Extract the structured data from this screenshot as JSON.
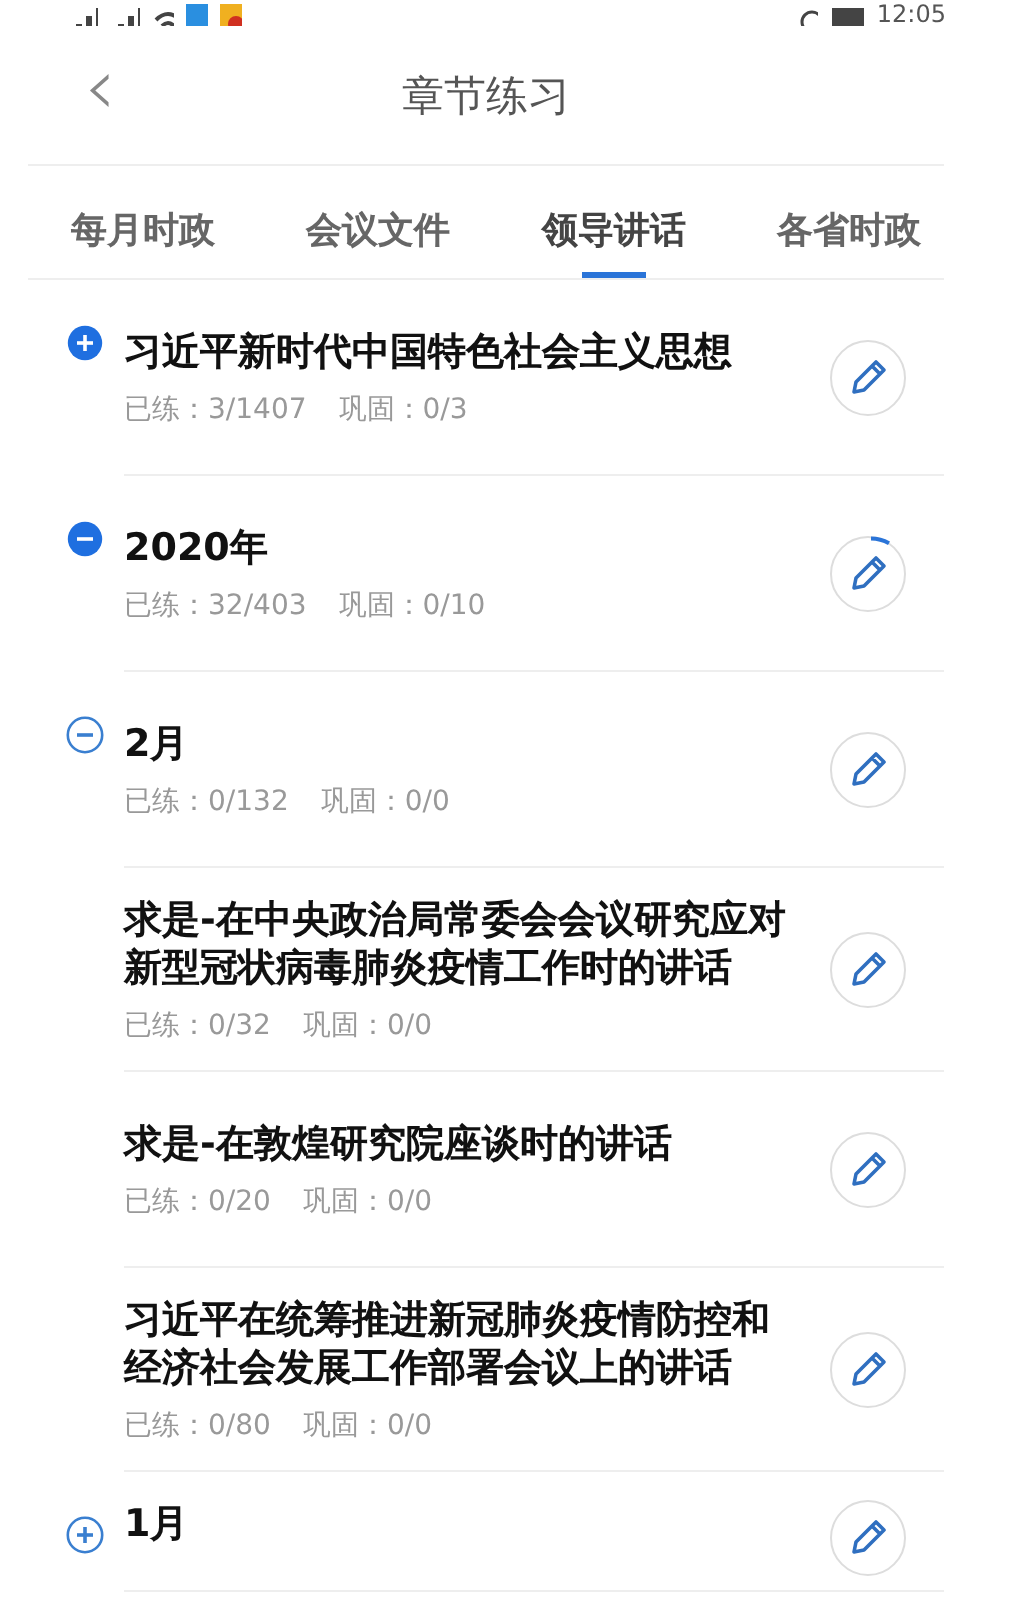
{
  "status_bar": {
    "time": "12:05"
  },
  "header": {
    "back_icon": "‹",
    "title": "章节练习"
  },
  "tabs": [
    {
      "label": "每月时政",
      "selected": false
    },
    {
      "label": "会议文件",
      "selected": false
    },
    {
      "label": "领导讲话",
      "selected": true
    },
    {
      "label": "各省时政",
      "selected": false
    }
  ],
  "items": [
    {
      "title": "习近平新时代中国特色社会主义思想",
      "practiced": "已练：3/1407",
      "review": "巩固：0/3",
      "expanded": false,
      "in_progress": false
    },
    {
      "title": "2020年",
      "practiced": "已练：32/403",
      "review": "巩固：0/10",
      "expanded": true,
      "in_progress": true,
      "children": [
        {
          "title": "2月",
          "practiced": "已练：0/132",
          "review": "巩固：0/0",
          "expanded": true,
          "in_progress": false,
          "children": [
            {
              "title": "求是-在中央政治局常委会会议研究应对新型冠状病毒肺炎疫情工作时的讲话",
              "practiced": "已练：0/32",
              "review": "巩固：0/0",
              "in_progress": false
            },
            {
              "title": "求是-在敦煌研究院座谈时的讲话",
              "practiced": "已练：0/20",
              "review": "巩固：0/0",
              "in_progress": false
            },
            {
              "title": "习近平在统筹推进新冠肺炎疫情防控和经济社会发展工作部署会议上的讲话",
              "practiced": "已练：0/80",
              "review": "巩固：0/0",
              "in_progress": false
            }
          ]
        },
        {
          "title": "1月",
          "expanded": false,
          "in_progress": false
        }
      ]
    }
  ]
}
